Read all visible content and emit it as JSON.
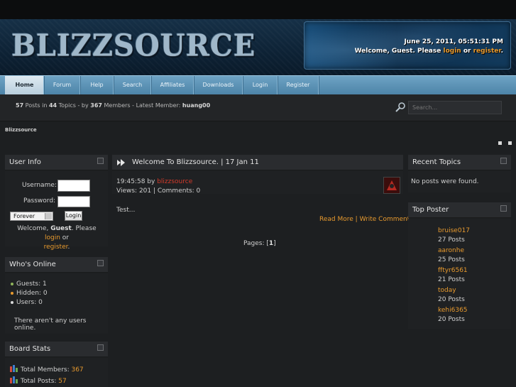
{
  "header": {
    "logo_text": "BLIZZSOURCE",
    "datetime": "June 25, 2011, 05:51:31 PM",
    "welcome_prefix": "Welcome, Guest. Please ",
    "login_link": "login",
    "or_text": " or ",
    "register_link": "register",
    "welcome_suffix": "."
  },
  "nav": {
    "items": [
      {
        "label": "Home",
        "active": true
      },
      {
        "label": "Forum"
      },
      {
        "label": "Help"
      },
      {
        "label": "Search"
      },
      {
        "label": "Affiliates"
      },
      {
        "label": "Downloads"
      },
      {
        "label": "Login"
      },
      {
        "label": "Register"
      }
    ]
  },
  "stats_bar": {
    "posts": "57",
    "posts_in": " Posts in ",
    "topics": "44",
    "topics_by": " Topics - by ",
    "members": "367",
    "members_latest": " Members - Latest Member: ",
    "latest_member": "huang00",
    "search_placeholder": "Search..."
  },
  "breadcrumb": "Blizzsource",
  "user_info": {
    "title": "User Info",
    "username_label": "Username:",
    "password_label": "Password:",
    "duration_value": "Forever",
    "login_button": "Login",
    "welcome_prefix": "Welcome, ",
    "guest": "Guest",
    "welcome_mid": ". Please ",
    "login_link": "login",
    "or_text": " or",
    "register_link": "register",
    "period": "."
  },
  "whos_online": {
    "title": "Who's Online",
    "guests": "Guests: 1",
    "hidden": "Hidden: 0",
    "users": "Users: 0",
    "none_text": "There aren't any users online."
  },
  "board_stats": {
    "title": "Board Stats",
    "total_members_label": "Total Members: ",
    "total_members": "367",
    "total_posts_label": "Total Posts: ",
    "total_posts": "57"
  },
  "news": {
    "title": "Welcome To Blizzsource. | 17 Jan 11",
    "time": "19:45:58",
    "by": " by ",
    "author": "blizzsource",
    "views_comments": "Views: 201 | Comments: 0",
    "body": "Test...",
    "read_more": "Read More",
    "separator": " | ",
    "write_comment": "Write Comment",
    "pages_label": "Pages: [",
    "page_current": "1",
    "pages_close": "]"
  },
  "recent_topics": {
    "title": "Recent Topics",
    "empty": "No posts were found."
  },
  "top_poster": {
    "title": "Top Poster",
    "posters": [
      {
        "name": "bruise017",
        "posts": "27 Posts"
      },
      {
        "name": "aaronhe",
        "posts": "25 Posts"
      },
      {
        "name": "fftyr6561",
        "posts": "21 Posts"
      },
      {
        "name": "today",
        "posts": "20 Posts"
      },
      {
        "name": "kehi6365",
        "posts": "20 Posts"
      }
    ]
  },
  "colors": {
    "accent_orange": "#e89a2e",
    "nav_blue": "#5b92b5",
    "author_red": "#d43a2a",
    "background": "#1d1f21"
  }
}
